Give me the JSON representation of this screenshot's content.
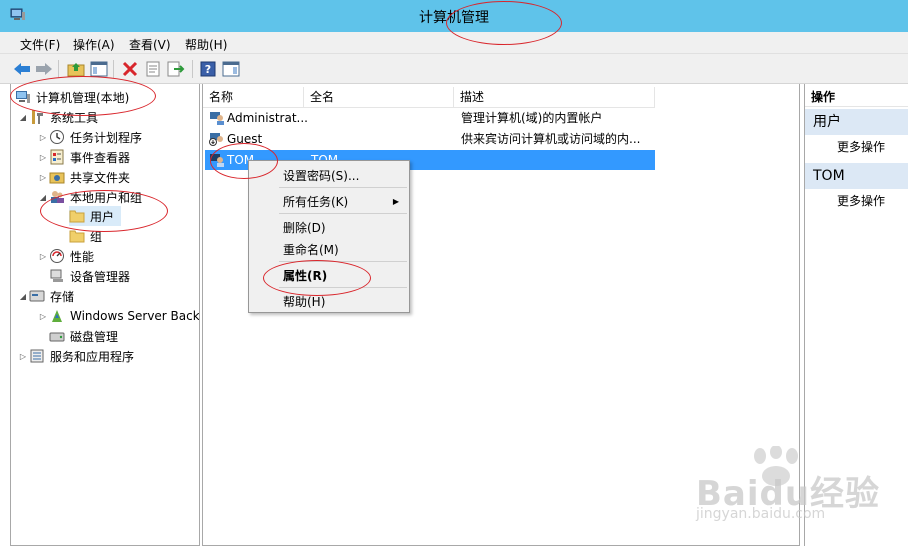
{
  "window": {
    "title": "计算机管理"
  },
  "menubar": [
    "文件(F)",
    "操作(A)",
    "查看(V)",
    "帮助(H)"
  ],
  "toolbar": {
    "icons": [
      "back-arrow-icon",
      "forward-arrow-icon",
      "up-folder-icon",
      "show-hide-console-tree-icon",
      "delete-icon",
      "properties-icon",
      "export-list-icon",
      "help-icon",
      "action-pane-icon"
    ]
  },
  "tree": [
    {
      "label": "计算机管理(本地)",
      "arrow": "",
      "icon": "computer-management-icon"
    },
    {
      "label": "系统工具",
      "arrow": "◢",
      "icon": "system-tools-icon"
    },
    {
      "label": "任务计划程序",
      "arrow": "▷",
      "icon": "task-scheduler-icon"
    },
    {
      "label": "事件查看器",
      "arrow": "▷",
      "icon": "event-viewer-icon"
    },
    {
      "label": "共享文件夹",
      "arrow": "▷",
      "icon": "shared-folders-icon"
    },
    {
      "label": "本地用户和组",
      "arrow": "◢",
      "icon": "local-users-groups-icon"
    },
    {
      "label": "用户",
      "arrow": "",
      "icon": "folder-icon"
    },
    {
      "label": "组",
      "arrow": "",
      "icon": "folder-icon"
    },
    {
      "label": "性能",
      "arrow": "▷",
      "icon": "performance-icon"
    },
    {
      "label": "设备管理器",
      "arrow": "",
      "icon": "device-manager-icon"
    },
    {
      "label": "存储",
      "arrow": "◢",
      "icon": "storage-icon"
    },
    {
      "label": "Windows Server Back",
      "arrow": "▷",
      "icon": "windows-server-backup-icon"
    },
    {
      "label": "磁盘管理",
      "arrow": "",
      "icon": "disk-management-icon"
    },
    {
      "label": "服务和应用程序",
      "arrow": "▷",
      "icon": "services-applications-icon"
    }
  ],
  "list": {
    "columns": [
      "名称",
      "全名",
      "描述"
    ],
    "rows": [
      {
        "name": "Administrat...",
        "fullname": "",
        "description": "管理计算机(域)的内置帐户"
      },
      {
        "name": "Guest",
        "fullname": "",
        "description": "供来宾访问计算机或访问域的内..."
      },
      {
        "name": "TOM",
        "fullname": "TOM",
        "description": ""
      }
    ]
  },
  "context_menu": {
    "items": [
      {
        "label": "设置密码(S)..."
      },
      {
        "label": "所有任务(K)",
        "submenu": "▶"
      },
      {
        "label": "删除(D)"
      },
      {
        "label": "重命名(M)"
      },
      {
        "label": "属性(R)"
      },
      {
        "label": "帮助(H)"
      }
    ]
  },
  "actions_pane": {
    "header": "操作",
    "sections": [
      {
        "title": "用户",
        "link": "更多操作"
      },
      {
        "title": "TOM",
        "link": "更多操作"
      }
    ]
  },
  "watermark": {
    "main": "Baidu经验",
    "sub": "jingyan.baidu.com"
  },
  "colors": {
    "titlebar": "#5fc3ea",
    "selection": "#3399ff",
    "annotation": "#d9262c",
    "section_bg": "#dce8f5"
  }
}
